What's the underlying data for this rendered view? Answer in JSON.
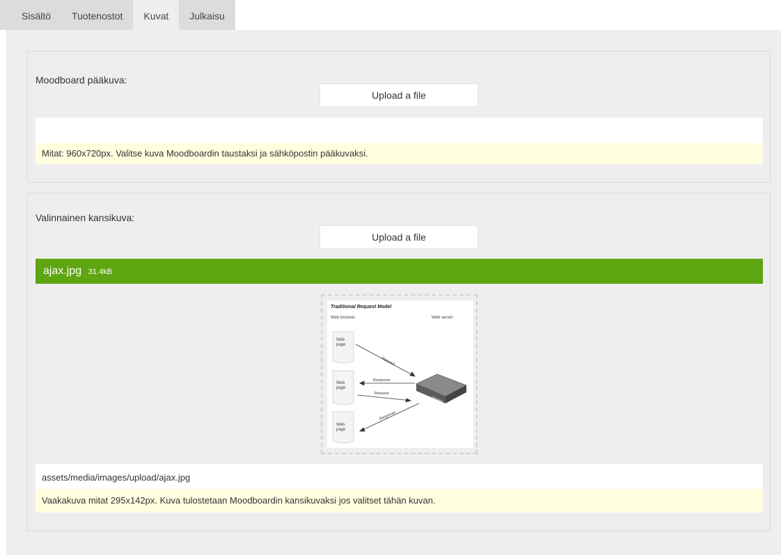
{
  "tabs": [
    {
      "label": "Sisältö"
    },
    {
      "label": "Tuotenostot"
    },
    {
      "label": "Kuvat"
    },
    {
      "label": "Julkaisu"
    }
  ],
  "active_tab": "Kuvat",
  "main_image": {
    "label": "Moodboard pääkuva:",
    "upload_label": "Upload a file",
    "path_value": "",
    "hint": "Mitat: 960x720px. Valitse kuva Moodboardin taustaksi ja sähköpostin pääkuvaksi."
  },
  "cover_image": {
    "label": "Valinnainen kansikuva:",
    "upload_label": "Upload a file",
    "file_name": "ajax.jpg",
    "file_size": "31.4kB",
    "preview": {
      "title": "Traditional Request Model",
      "web_browser": "Web browser",
      "web_server": "Web server",
      "page_word1": "Web",
      "page_word2": "page",
      "request": "Request",
      "response": "Response"
    },
    "path_value": "assets/media/images/upload/ajax.jpg",
    "hint": "Vaakakuva mitat 295x142px. Kuva tulostetaan Moodboardin kansikuvaksi jos valitset tähän kuvan."
  },
  "colors": {
    "file_bar": "#5ea512",
    "hint_bg": "#ffffe0",
    "panel_bg": "#eeeeee"
  }
}
